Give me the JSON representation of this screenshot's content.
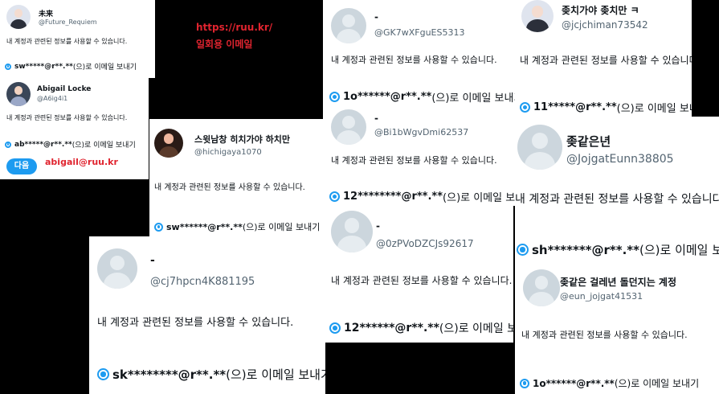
{
  "common": {
    "desc": "내 계정과 관련된 정보를 사용할 수 있습니다.",
    "send_suffix": "(으)로 이메일 보내기"
  },
  "overlay": {
    "url": "https://ruu.kr/",
    "label": "일회용 이메일",
    "email": "abigail@ruu.kr"
  },
  "cards": {
    "c1": {
      "name": "未来",
      "handle": "@Future_Requiem",
      "email_masked": "sw*****@r**.**"
    },
    "c2": {
      "name": "Abigail Locke",
      "handle": "@A6ig4i1",
      "email_masked": "ab*****@r**.**",
      "next_label": "다음"
    },
    "c3": {
      "name": "스윗남창 히치가야 하치만",
      "handle": "@hichigaya1070",
      "email_masked": "sw******@r**.**"
    },
    "c4": {
      "name": "-",
      "handle": "@cj7hpcn4K881195",
      "email_masked": "sk********@r**.**"
    },
    "c5": {
      "name": "-",
      "handle": "@GK7wXFguES5313",
      "email_masked": "1o******@r**.**"
    },
    "c6": {
      "name": "-",
      "handle": "@Bi1bWgvDmi62537",
      "email_masked": "12********@r**.**"
    },
    "c7": {
      "name": "-",
      "handle": "@0zPVoDZCJs92617",
      "email_masked": "12******@r**.**"
    },
    "c8": {
      "name": "좆치가야 좆치만 ㅋ",
      "handle": "@jcjchiman73542",
      "email_masked": "11*****@r**.**"
    },
    "c9": {
      "name": "좆같은년",
      "handle": "@JojgatEunn38805",
      "email_masked": "sh*******@r**.**"
    },
    "c10": {
      "name": "좆같은 걸레년 돌던지는 계정",
      "handle": "@eun_jojgat41531",
      "email_masked": "1o******@r**.**"
    }
  }
}
